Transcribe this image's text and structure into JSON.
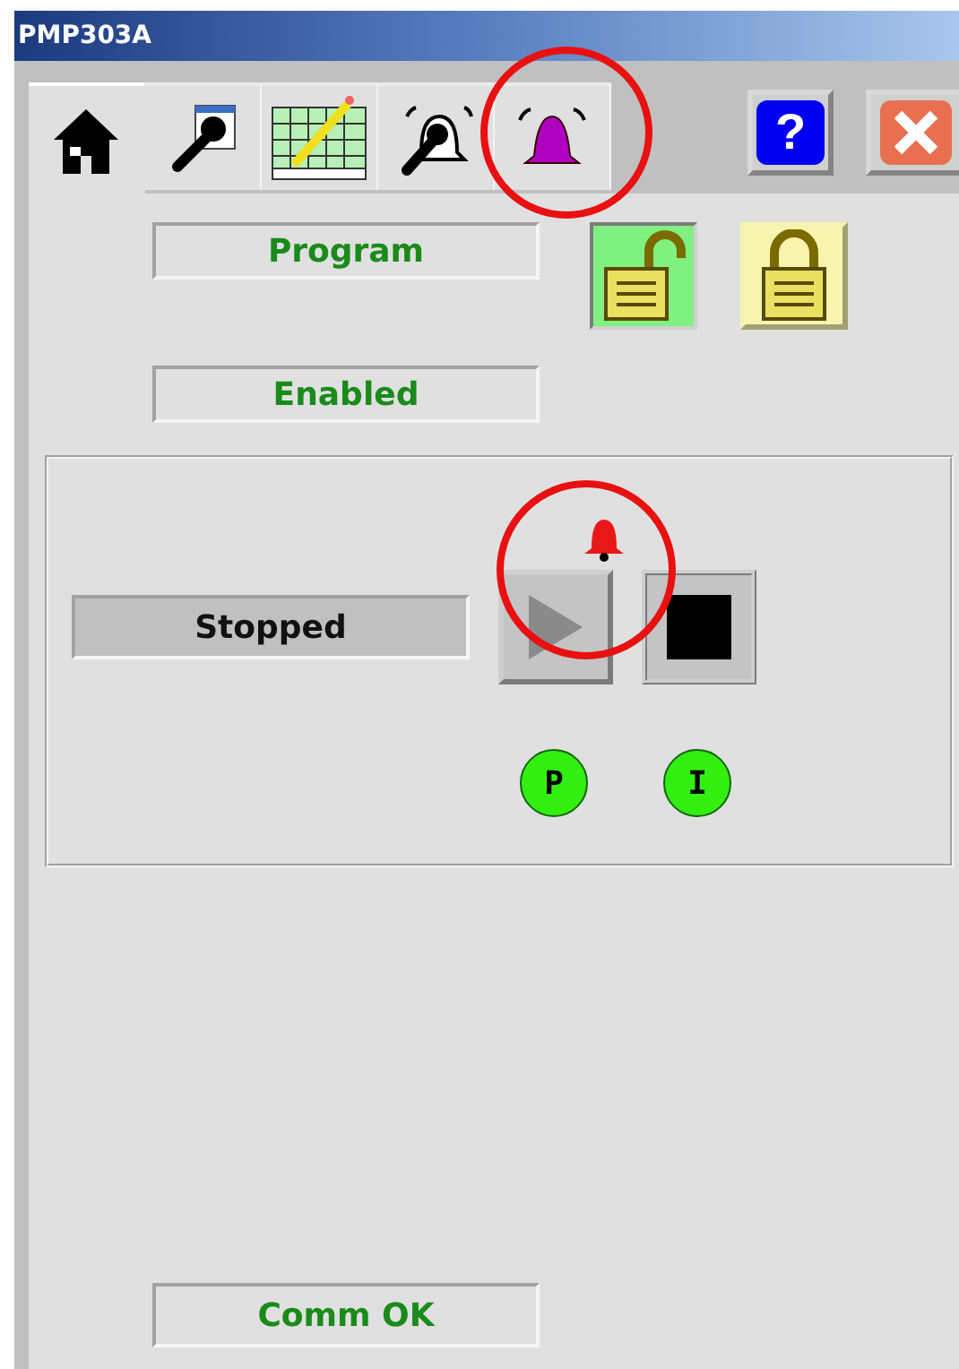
{
  "window": {
    "title": "PMP303A"
  },
  "tabs": [
    {
      "selected": true,
      "highlighted": false
    },
    {
      "selected": false,
      "highlighted": false
    },
    {
      "selected": false,
      "highlighted": false
    },
    {
      "selected": false,
      "highlighted": false
    },
    {
      "selected": false,
      "highlighted": true
    }
  ],
  "help_button": {
    "label": "?"
  },
  "mode": {
    "value": "Program"
  },
  "locks": [
    {
      "kind": "unlocked",
      "selected": true
    },
    {
      "kind": "locked",
      "selected": false
    }
  ],
  "enable_status": {
    "value": "Enabled"
  },
  "run_panel": {
    "alarm": {
      "active": true,
      "highlighted": true
    },
    "state": "Stopped",
    "start_disabled": true,
    "indicators": [
      {
        "label": "P",
        "color": "#33ee11"
      },
      {
        "label": "I",
        "color": "#33ee11"
      }
    ]
  },
  "comm_status": {
    "value": "Comm OK"
  }
}
